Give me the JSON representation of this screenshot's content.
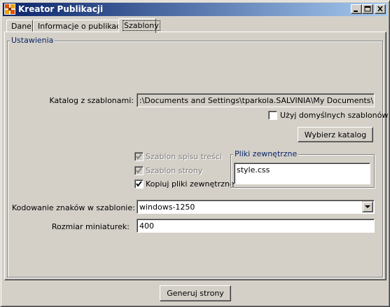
{
  "window": {
    "title": "Kreator Publikacji",
    "controls": [
      "minimize",
      "maximize",
      "close"
    ]
  },
  "tabs": [
    {
      "label": "Dane",
      "active": false
    },
    {
      "label": "Informacje o publikacji",
      "active": false
    },
    {
      "label": "Szablony",
      "active": true
    }
  ],
  "settings": {
    "legend": "Ustawienia",
    "template_dir_label": "Katalog z szablonami:",
    "template_dir_value": ":\\Documents and Settings\\tparkola.SALVINIA\\My Documents\\pubcre",
    "use_default_label": "Użyj domyślnych szablonów",
    "use_default_checked": false,
    "choose_dir_button": "Wybierz katalog",
    "toc_template_label": "Szablon spisu treści",
    "toc_template_checked": true,
    "page_template_label": "Szablon strony",
    "page_template_checked": true,
    "copy_files_label": "Kopiuj pliki zewnętrzne",
    "copy_files_checked": true,
    "external_files_legend": "Pliki zewnętrzne",
    "external_files": [
      "style.css"
    ],
    "encoding_label": "Kodowanie znaków w szablonie:",
    "encoding_value": "windows-1250",
    "thumb_size_label": "Rozmiar miniaturek:",
    "thumb_size_value": "400"
  },
  "footer": {
    "generate_button": "Generuj strony"
  },
  "colors": {
    "titlebar_start": "#0a246a",
    "titlebar_end": "#a6caf0",
    "face": "#d4d0c8",
    "legend_text": "#0a246a"
  },
  "icons": {
    "app": "publication-icon",
    "minimize": "minimize-icon",
    "maximize": "maximize-icon",
    "close": "close-icon",
    "dropdown": "chevron-down-icon",
    "check": "checkmark-icon"
  }
}
